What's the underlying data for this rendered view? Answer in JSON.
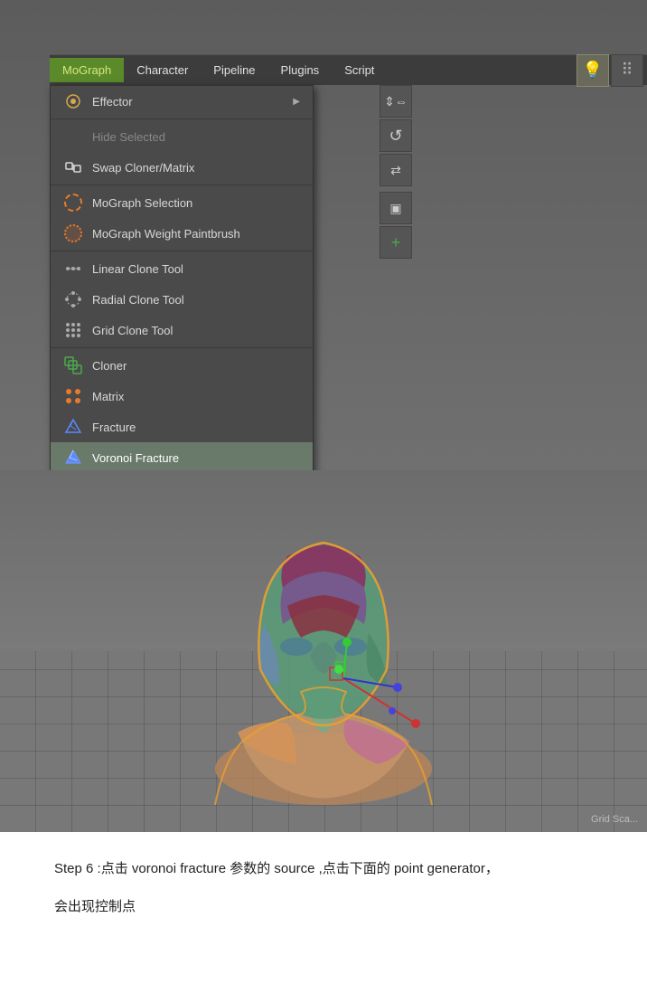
{
  "menu": {
    "bar": {
      "items": [
        {
          "label": "MoGraph",
          "active": true
        },
        {
          "label": "Character",
          "active": false
        },
        {
          "label": "Pipeline",
          "active": false
        },
        {
          "label": "Plugins",
          "active": false
        },
        {
          "label": "Script",
          "active": false
        }
      ]
    },
    "dropdown": {
      "items": [
        {
          "id": "effector",
          "label": "Effector",
          "hasArrow": true,
          "icon": "effector",
          "disabled": false
        },
        {
          "id": "hide-selected",
          "label": "Hide Selected",
          "hasArrow": false,
          "icon": "none",
          "disabled": true
        },
        {
          "id": "swap-cloner",
          "label": "Swap Cloner/Matrix",
          "hasArrow": false,
          "icon": "swap",
          "disabled": false
        },
        {
          "id": "mograph-selection",
          "label": "MoGraph Selection",
          "hasArrow": false,
          "icon": "selection",
          "disabled": false
        },
        {
          "id": "mograph-weight",
          "label": "MoGraph Weight Paintbrush",
          "hasArrow": false,
          "icon": "weight",
          "disabled": false
        },
        {
          "id": "linear-clone",
          "label": "Linear Clone Tool",
          "hasArrow": false,
          "icon": "linear",
          "disabled": false
        },
        {
          "id": "radial-clone",
          "label": "Radial Clone Tool",
          "hasArrow": false,
          "icon": "radial",
          "disabled": false
        },
        {
          "id": "grid-clone",
          "label": "Grid Clone Tool",
          "hasArrow": false,
          "icon": "grid",
          "disabled": false
        },
        {
          "id": "cloner",
          "label": "Cloner",
          "hasArrow": false,
          "icon": "cloner",
          "disabled": false
        },
        {
          "id": "matrix",
          "label": "Matrix",
          "hasArrow": false,
          "icon": "matrix",
          "disabled": false
        },
        {
          "id": "fracture",
          "label": "Fracture",
          "hasArrow": false,
          "icon": "fracture",
          "disabled": false
        },
        {
          "id": "voronoi-fracture",
          "label": "Voronoi Fracture",
          "hasArrow": false,
          "icon": "voronoi",
          "disabled": false,
          "highlighted": true
        }
      ]
    }
  },
  "viewport": {
    "grid_label": "Grid Sca..."
  },
  "step_text": {
    "line1": "Step 6 :点击 voronoi fracture  参数的 source ,点击下面的 point generator，",
    "line2": "会出现控制点"
  }
}
